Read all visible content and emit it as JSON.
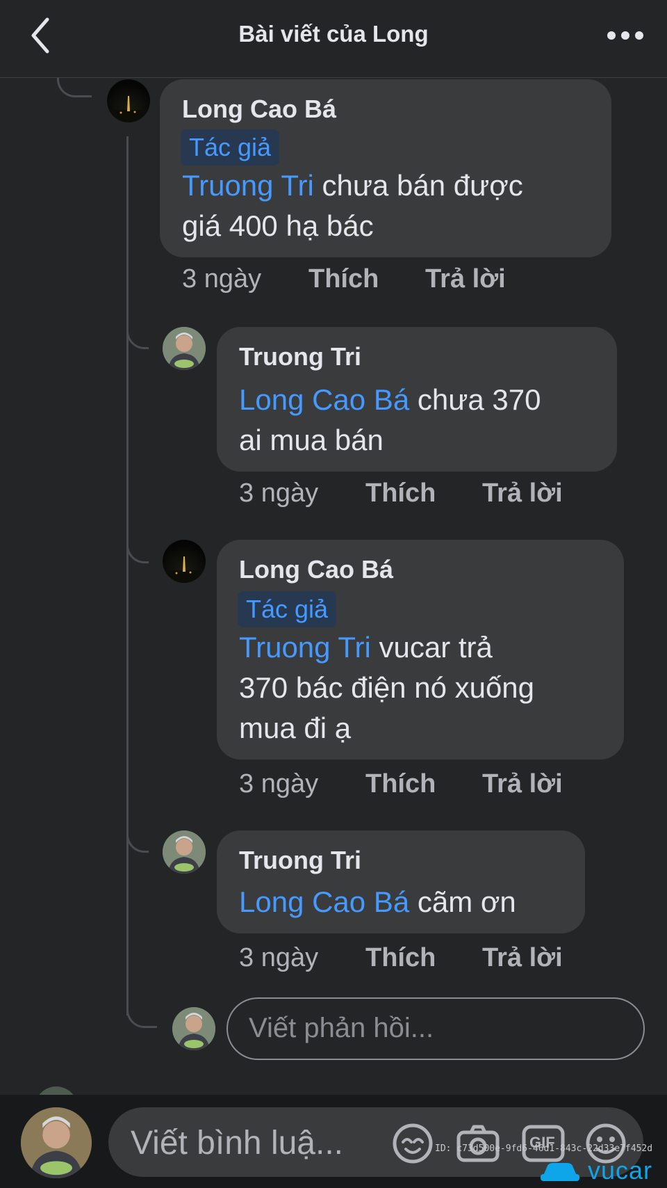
{
  "header": {
    "title": "Bài viết của Long"
  },
  "comments": [
    {
      "author": "Long Cao Bá",
      "badge": "Tác giả",
      "mention": "Truong Tri",
      "line1_rest": " chưa bán được",
      "line2": "giá 400 hạ bác",
      "time": "3 ngày",
      "like": "Thích",
      "reply": "Trả lời"
    },
    {
      "author": "Truong Tri",
      "mention": "Long Cao Bá",
      "line1_rest": " chưa 370",
      "line2": "ai mua bán",
      "time": "3 ngày",
      "like": "Thích",
      "reply": "Trả lời"
    },
    {
      "author": "Long Cao Bá",
      "badge": "Tác giả",
      "mention": "Truong Tri",
      "line1_rest": " vucar trả",
      "line2": "370 bác điện nó xuống",
      "line3": "mua đi ạ",
      "time": "3 ngày",
      "like": "Thích",
      "reply": "Trả lời"
    },
    {
      "author": "Truong Tri",
      "mention": "Long Cao Bá",
      "line1_rest": " cãm ơn",
      "time": "3 ngày",
      "like": "Thích",
      "reply": "Trả lời"
    }
  ],
  "reply_box": {
    "placeholder": "Viết phản hồi..."
  },
  "bottom_bar": {
    "placeholder": "Viết bình luậ...",
    "icons": [
      "sticker-icon",
      "camera-icon",
      "gif-icon",
      "emoji-icon"
    ],
    "gif_label": "GIF"
  },
  "watermark": {
    "id_text": "ID: c73d500e-9fd6-46d1-843c-22d33e7f452d",
    "brand": "vucar"
  },
  "colors": {
    "background": "#242526",
    "bubble": "#3a3b3c",
    "mention": "#4599ff",
    "badge_bg": "#263951",
    "secondary_text": "#b0b3b8",
    "brand": "#0ea5e9"
  }
}
